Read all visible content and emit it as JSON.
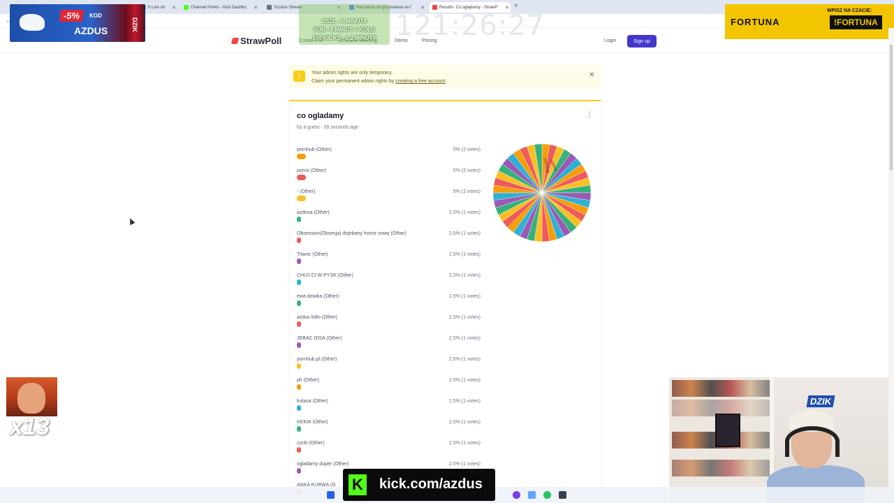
{
  "tabs": [
    {
      "label": "h Live on",
      "color": "#9ca3af"
    },
    {
      "label": "Channel Points - Kick Dashbo",
      "color": "#53fc18"
    },
    {
      "label": "Szzdus Stream",
      "color": "#6b7280"
    },
    {
      "label": "Narzędzia do głosowania na f",
      "color": "#3b82f6"
    },
    {
      "label": "Results: Co oglądamy - StrawP",
      "color": "#ef4444"
    }
  ],
  "nav": {
    "logo": "StrawPoll",
    "links": [
      "Create Poll",
      "Schedule Meeting",
      "Demo",
      "Pricing"
    ],
    "login": "Login",
    "signup": "Sign up"
  },
  "overlay": {
    "discount": "-5%",
    "kod": "KOD",
    "code": "AZDUS",
    "can": "DZIK",
    "promo": [
      "2,5ZŁ - 1 MINUTA",
      "SUB - 8 MINUT + KOŁO",
      "100 KICKS - 1,2 MINUTY"
    ],
    "timer": "121:26:27",
    "right_small": "WPISZ NA CZACIE:",
    "right_brand": "FORTUNA",
    "right_tag": "!FORTUNA",
    "emote_count": "x13",
    "cam_logo": "DZIK",
    "kick_url": "kick.com/azdus"
  },
  "alert": {
    "line1": "Your admin rights are only temporary.",
    "line2_prefix": "Claim your permanent admin rights by ",
    "link": "creating a free account",
    "line2_suffix": "."
  },
  "poll": {
    "title": "co ogladamy",
    "meta": "by a guest · 28 seconds ago",
    "options": [
      {
        "label": "pornhub (Other)",
        "value": "5% (2 votes)",
        "pct": 5,
        "color": "#f59e0b"
      },
      {
        "label": "porno (Other)",
        "value": "5% (2 votes)",
        "pct": 5,
        "color": "#ef5a5a"
      },
      {
        "label": "- (Other)",
        "value": "5% (2 votes)",
        "pct": 5,
        "color": "#fbbf24"
      },
      {
        "label": "azdusa (Other)",
        "value": "2,5% (1 votes)",
        "pct": 2.5,
        "color": "#34b27b"
      },
      {
        "label": "Obsession(Obsesja) dojebany horror nowy (Other)",
        "value": "2,5% (1 votes)",
        "pct": 2.5,
        "color": "#ef5a5a"
      },
      {
        "label": "Titanic (Other)",
        "value": "2,5% (1 votes)",
        "pct": 2.5,
        "color": "#9b59b6"
      },
      {
        "label": "CHUJ CI W PYSK (Other)",
        "value": "2,5% (1 votes)",
        "pct": 2.5,
        "color": "#2eb0d6"
      },
      {
        "label": "ewa dziwka (Other)",
        "value": "2,5% (1 votes)",
        "pct": 2.5,
        "color": "#34b27b"
      },
      {
        "label": "azdus lotto (Other)",
        "value": "2,5% (1 votes)",
        "pct": 2.5,
        "color": "#ef5a5a"
      },
      {
        "label": "JEBAC DISA (Other)",
        "value": "2,5% (1 votes)",
        "pct": 2.5,
        "color": "#9b59b6"
      },
      {
        "label": "pornhub.pl (Other)",
        "value": "2,5% (1 votes)",
        "pct": 2.5,
        "color": "#fbbf24"
      },
      {
        "label": "ph (Other)",
        "value": "2,5% (1 votes)",
        "pct": 2.5,
        "color": "#f59e0b"
      },
      {
        "label": "kutasa (Other)",
        "value": "2,5% (1 votes)",
        "pct": 2.5,
        "color": "#2eb0d6"
      },
      {
        "label": "KEKW (Other)",
        "value": "2,5% (1 votes)",
        "pct": 2.5,
        "color": "#34b27b"
      },
      {
        "label": "cycki (Other)",
        "value": "2,5% (1 votes)",
        "pct": 2.5,
        "color": "#ef5a5a"
      },
      {
        "label": "ogladamy duper (Other)",
        "value": "2,5% (1 votes)",
        "pct": 2.5,
        "color": "#9b59b6"
      },
      {
        "label": "ANKA KURWA (O",
        "value": "",
        "pct": 2.5,
        "color": "#fbbf24"
      }
    ],
    "wheel_labels": [
      "pornhub",
      "porno"
    ],
    "wheel_palette": [
      "#f59e0b",
      "#ef5a5a",
      "#fbbf24",
      "#34b27b",
      "#9b59b6",
      "#2eb0d6"
    ]
  }
}
